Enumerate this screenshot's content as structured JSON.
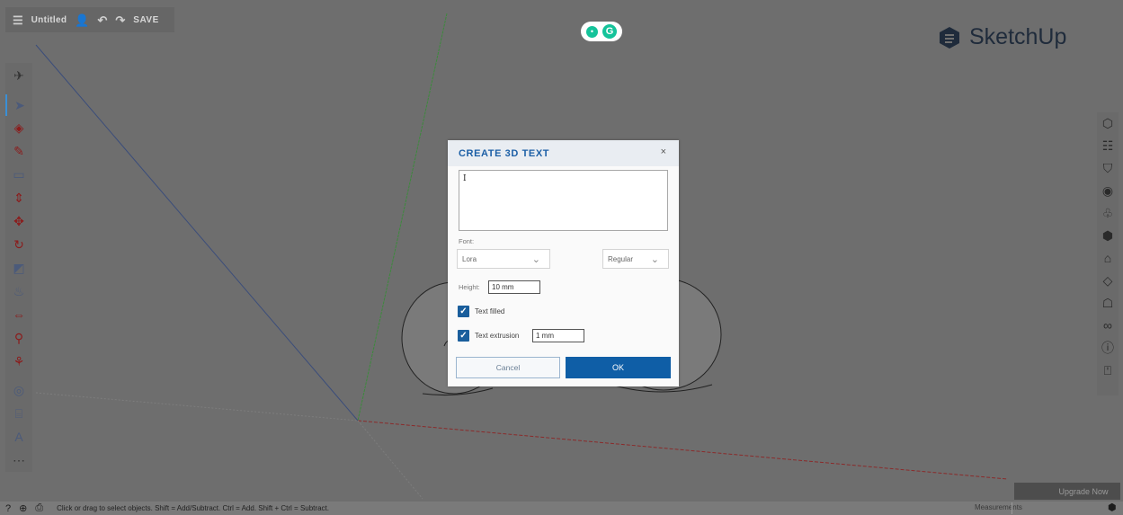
{
  "topbar": {
    "menu_icon": "hamburger-menu-icon",
    "title": "Untitled",
    "user_icon": "user-icon",
    "undo_icon": "undo-icon",
    "redo_icon": "redo-icon",
    "save_label": "SAVE"
  },
  "brand": {
    "name": "SketchUp",
    "logo_icon": "sketchup-logo-icon"
  },
  "grammarly": {
    "badge_icon": "grammarly-icon",
    "letter": "G"
  },
  "left_toolbar": [
    {
      "name": "3d-warehouse-icon"
    },
    {
      "name": "select-tool-icon",
      "selected": true
    },
    {
      "name": "eraser-icon"
    },
    {
      "name": "pencil-line-icon"
    },
    {
      "name": "rectangle-icon"
    },
    {
      "name": "push-pull-icon"
    },
    {
      "name": "move-icon"
    },
    {
      "name": "rotate-icon"
    },
    {
      "name": "scale-icon"
    },
    {
      "name": "paint-bucket-icon"
    },
    {
      "name": "offset-icon"
    },
    {
      "name": "follow-me-icon"
    },
    {
      "name": "orbit-icon"
    },
    {
      "name": "tape-measure-icon"
    },
    {
      "name": "text-label-icon"
    },
    {
      "name": "3d-text-icon"
    },
    {
      "name": "more-tools-icon"
    }
  ],
  "right_toolbar": [
    {
      "name": "entity-info-icon"
    },
    {
      "name": "outliner-icon"
    },
    {
      "name": "components-icon"
    },
    {
      "name": "materials-icon"
    },
    {
      "name": "styles-icon"
    },
    {
      "name": "tags-icon"
    },
    {
      "name": "scenes-icon"
    },
    {
      "name": "display-icon"
    },
    {
      "name": "solid-inspector-icon"
    },
    {
      "name": "infinity-icon"
    },
    {
      "name": "info-icon"
    },
    {
      "name": "instructor-icon"
    }
  ],
  "dialog": {
    "title": "CREATE 3D TEXT",
    "close": "×",
    "text_value": "I",
    "font_label": "Font:",
    "font_value": "Lora",
    "style_value": "Regular",
    "height_label": "Height:",
    "height_value": "10 mm",
    "text_filled_label": "Text filled",
    "text_filled_checked": true,
    "text_extrusion_label": "Text extrusion",
    "text_extrusion_checked": true,
    "extrusion_value": "1 mm",
    "cancel_label": "Cancel",
    "ok_label": "OK"
  },
  "upgrade": {
    "label": "Upgrade Now"
  },
  "statusbar": {
    "help_icon": "help-icon",
    "globe_icon": "globe-icon",
    "save_status_icon": "save-status-icon",
    "hint": "Click or drag to select objects. Shift = Add/Subtract. Ctrl = Add. Shift + Ctrl = Subtract.",
    "measurements_label": "Measurements",
    "sketchup_icon": "sketchup-status-icon"
  },
  "colors": {
    "dialog_title": "#1c5fa6",
    "ok_button": "#0f5ea6",
    "checkbox": "#1a5e9c",
    "brand_text": "#1f2b3b",
    "axis_red": "#8a2b2b",
    "axis_green": "#3c8a3c",
    "axis_blue": "#3b4d7a"
  }
}
